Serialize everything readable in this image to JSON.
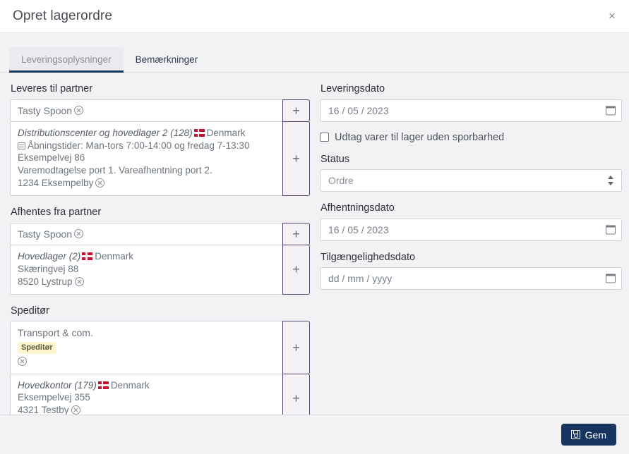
{
  "header": {
    "title": "Opret lagerordre",
    "close_label": "×"
  },
  "tabs": [
    {
      "label": "Leveringsoplysninger",
      "active": true
    },
    {
      "label": "Bemærkninger",
      "active": false
    }
  ],
  "colors": {
    "accent": "#17355f",
    "plus_border": "#54426b",
    "badge_bg": "#fdf5cf",
    "flag_red": "#c8102e",
    "page_bg": "#f2f2f5"
  },
  "left": {
    "delivery_partner": {
      "label": "Leveres til partner",
      "value": "Tasty Spoon",
      "plus_label": "+",
      "address": {
        "title": "Distributionscenter og hovedlager 2 (128)",
        "country": "Denmark",
        "note": "Åbningstider: Man-tors 7:00-14:00 og fredag 7-13:30",
        "lines": [
          "Eksempelvej 86",
          "Varemodtagelse port 1. Vareafhentning port 2."
        ],
        "city": "1234 Eksempelby",
        "plus_label": "+"
      }
    },
    "pickup_partner": {
      "label": "Afhentes fra partner",
      "value": "Tasty Spoon",
      "plus_label": "+",
      "address": {
        "title": "Hovedlager (2)",
        "country": "Denmark",
        "lines": [
          "Skæringvej 88"
        ],
        "city": "8520 Lystrup",
        "plus_label": "+"
      }
    },
    "forwarder": {
      "label": "Speditør",
      "company": "Transport & com.",
      "badge": "Speditør",
      "plus_label": "+",
      "address": {
        "title": "Hovedkontor (179)",
        "country": "Denmark",
        "lines": [
          "Eksempelvej 355"
        ],
        "city": "4321 Testby",
        "plus_label": "+"
      }
    }
  },
  "right": {
    "delivery_date": {
      "label": "Leveringsdato",
      "value": "16 / 05 / 2023",
      "placeholder": "dd / mm / yyyy"
    },
    "no_traceability": {
      "label": "Udtag varer til lager uden sporbarhed",
      "checked": false
    },
    "status": {
      "label": "Status",
      "value": "Ordre",
      "options": [
        "Ordre"
      ]
    },
    "pickup_date": {
      "label": "Afhentningsdato",
      "value": "16 / 05 / 2023",
      "placeholder": "dd / mm / yyyy"
    },
    "availability_date": {
      "label": "Tilgængelighedsdato",
      "value": "dd / mm / yyyy",
      "placeholder": "dd / mm / yyyy"
    }
  },
  "footer": {
    "save_label": "Gem"
  }
}
